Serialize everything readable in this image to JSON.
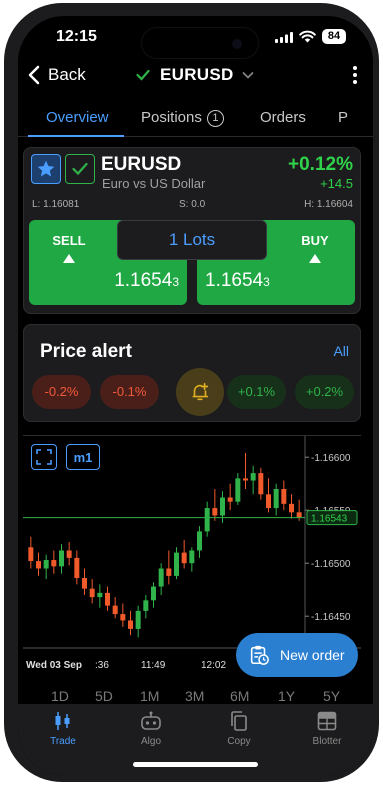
{
  "status": {
    "time": "12:15",
    "battery": "84"
  },
  "nav": {
    "back_label": "Back",
    "title": "EURUSD"
  },
  "tabs": [
    {
      "label": "Overview"
    },
    {
      "label": "Positions",
      "badge": "1"
    },
    {
      "label": "Orders"
    },
    {
      "label": "P"
    }
  ],
  "instrument": {
    "symbol": "EURUSD",
    "description": "Euro vs US Dollar",
    "change_pct": "+0.12%",
    "change_pts": "+14.5",
    "low": "L: 1.16081",
    "spread": "S: 0.0",
    "high": "H: 1.16604",
    "sell_label": "SELL",
    "buy_label": "BUY",
    "lots": "1 Lots",
    "sell_price_main": "1.1654",
    "sell_price_pip": "3",
    "buy_price_main": "1.1654",
    "buy_price_pip": "3"
  },
  "alert": {
    "title": "Price alert",
    "all_label": "All",
    "pills": [
      "-0.2%",
      "-0.1%",
      "+0.1%",
      "+0.2%"
    ]
  },
  "chart": {
    "timeframe": "m1",
    "price_labels": [
      "1.16600",
      "1.16550",
      "1.16500",
      "1.16450"
    ],
    "current_price": "1.16543",
    "time_labels": [
      "Wed 03 Sep",
      ":36",
      "11:49",
      "12:02"
    ],
    "colors": {
      "up": "#2fb34a",
      "down": "#f15a2a",
      "current_line": "#2fb34a"
    }
  },
  "chart_data": {
    "type": "candlestick",
    "ylim": [
      1.1642,
      1.1662
    ],
    "up_color": "#2fb34a",
    "down_color": "#f15a2a",
    "candles": [
      [
        1.16515,
        1.16525,
        1.16495,
        1.16502
      ],
      [
        1.16502,
        1.1651,
        1.16488,
        1.16495
      ],
      [
        1.16495,
        1.16508,
        1.16485,
        1.16503
      ],
      [
        1.16503,
        1.16512,
        1.1649,
        1.16497
      ],
      [
        1.16497,
        1.16518,
        1.1649,
        1.16512
      ],
      [
        1.16512,
        1.1652,
        1.16498,
        1.16505
      ],
      [
        1.16505,
        1.16512,
        1.1648,
        1.16486
      ],
      [
        1.16486,
        1.16495,
        1.1647,
        1.16476
      ],
      [
        1.16476,
        1.16485,
        1.16462,
        1.16468
      ],
      [
        1.16468,
        1.1648,
        1.16458,
        1.16472
      ],
      [
        1.16472,
        1.16478,
        1.16455,
        1.1646
      ],
      [
        1.1646,
        1.16468,
        1.16448,
        1.16452
      ],
      [
        1.16452,
        1.16462,
        1.1644,
        1.16446
      ],
      [
        1.16446,
        1.16455,
        1.16432,
        1.16438
      ],
      [
        1.16438,
        1.1646,
        1.1643,
        1.16455
      ],
      [
        1.16455,
        1.1647,
        1.16448,
        1.16465
      ],
      [
        1.16465,
        1.16482,
        1.16458,
        1.16478
      ],
      [
        1.16478,
        1.165,
        1.1647,
        1.16495
      ],
      [
        1.16495,
        1.16512,
        1.1648,
        1.16488
      ],
      [
        1.16488,
        1.16515,
        1.16485,
        1.1651
      ],
      [
        1.1651,
        1.16522,
        1.16495,
        1.165
      ],
      [
        1.165,
        1.16515,
        1.16492,
        1.16512
      ],
      [
        1.16512,
        1.16535,
        1.16505,
        1.1653
      ],
      [
        1.1653,
        1.16558,
        1.16525,
        1.16552
      ],
      [
        1.16552,
        1.1657,
        1.1654,
        1.16545
      ],
      [
        1.16545,
        1.16568,
        1.16538,
        1.16562
      ],
      [
        1.16562,
        1.16575,
        1.1655,
        1.16558
      ],
      [
        1.16558,
        1.16585,
        1.16555,
        1.1658
      ],
      [
        1.1658,
        1.16604,
        1.1657,
        1.16578
      ],
      [
        1.16578,
        1.16592,
        1.16565,
        1.16585
      ],
      [
        1.16585,
        1.1659,
        1.1656,
        1.16565
      ],
      [
        1.16565,
        1.1658,
        1.16548,
        1.16552
      ],
      [
        1.16552,
        1.16575,
        1.16545,
        1.1657
      ],
      [
        1.1657,
        1.16578,
        1.1655,
        1.16556
      ],
      [
        1.16556,
        1.16565,
        1.16542,
        1.16548
      ],
      [
        1.16548,
        1.1656,
        1.1654,
        1.16543
      ]
    ]
  },
  "timeframes": [
    "1D",
    "5D",
    "1M",
    "3M",
    "6M",
    "1Y",
    "5Y"
  ],
  "new_order": {
    "label": "New order"
  },
  "bottom_nav": [
    {
      "label": "Trade"
    },
    {
      "label": "Algo"
    },
    {
      "label": "Copy"
    },
    {
      "label": "Blotter"
    }
  ]
}
